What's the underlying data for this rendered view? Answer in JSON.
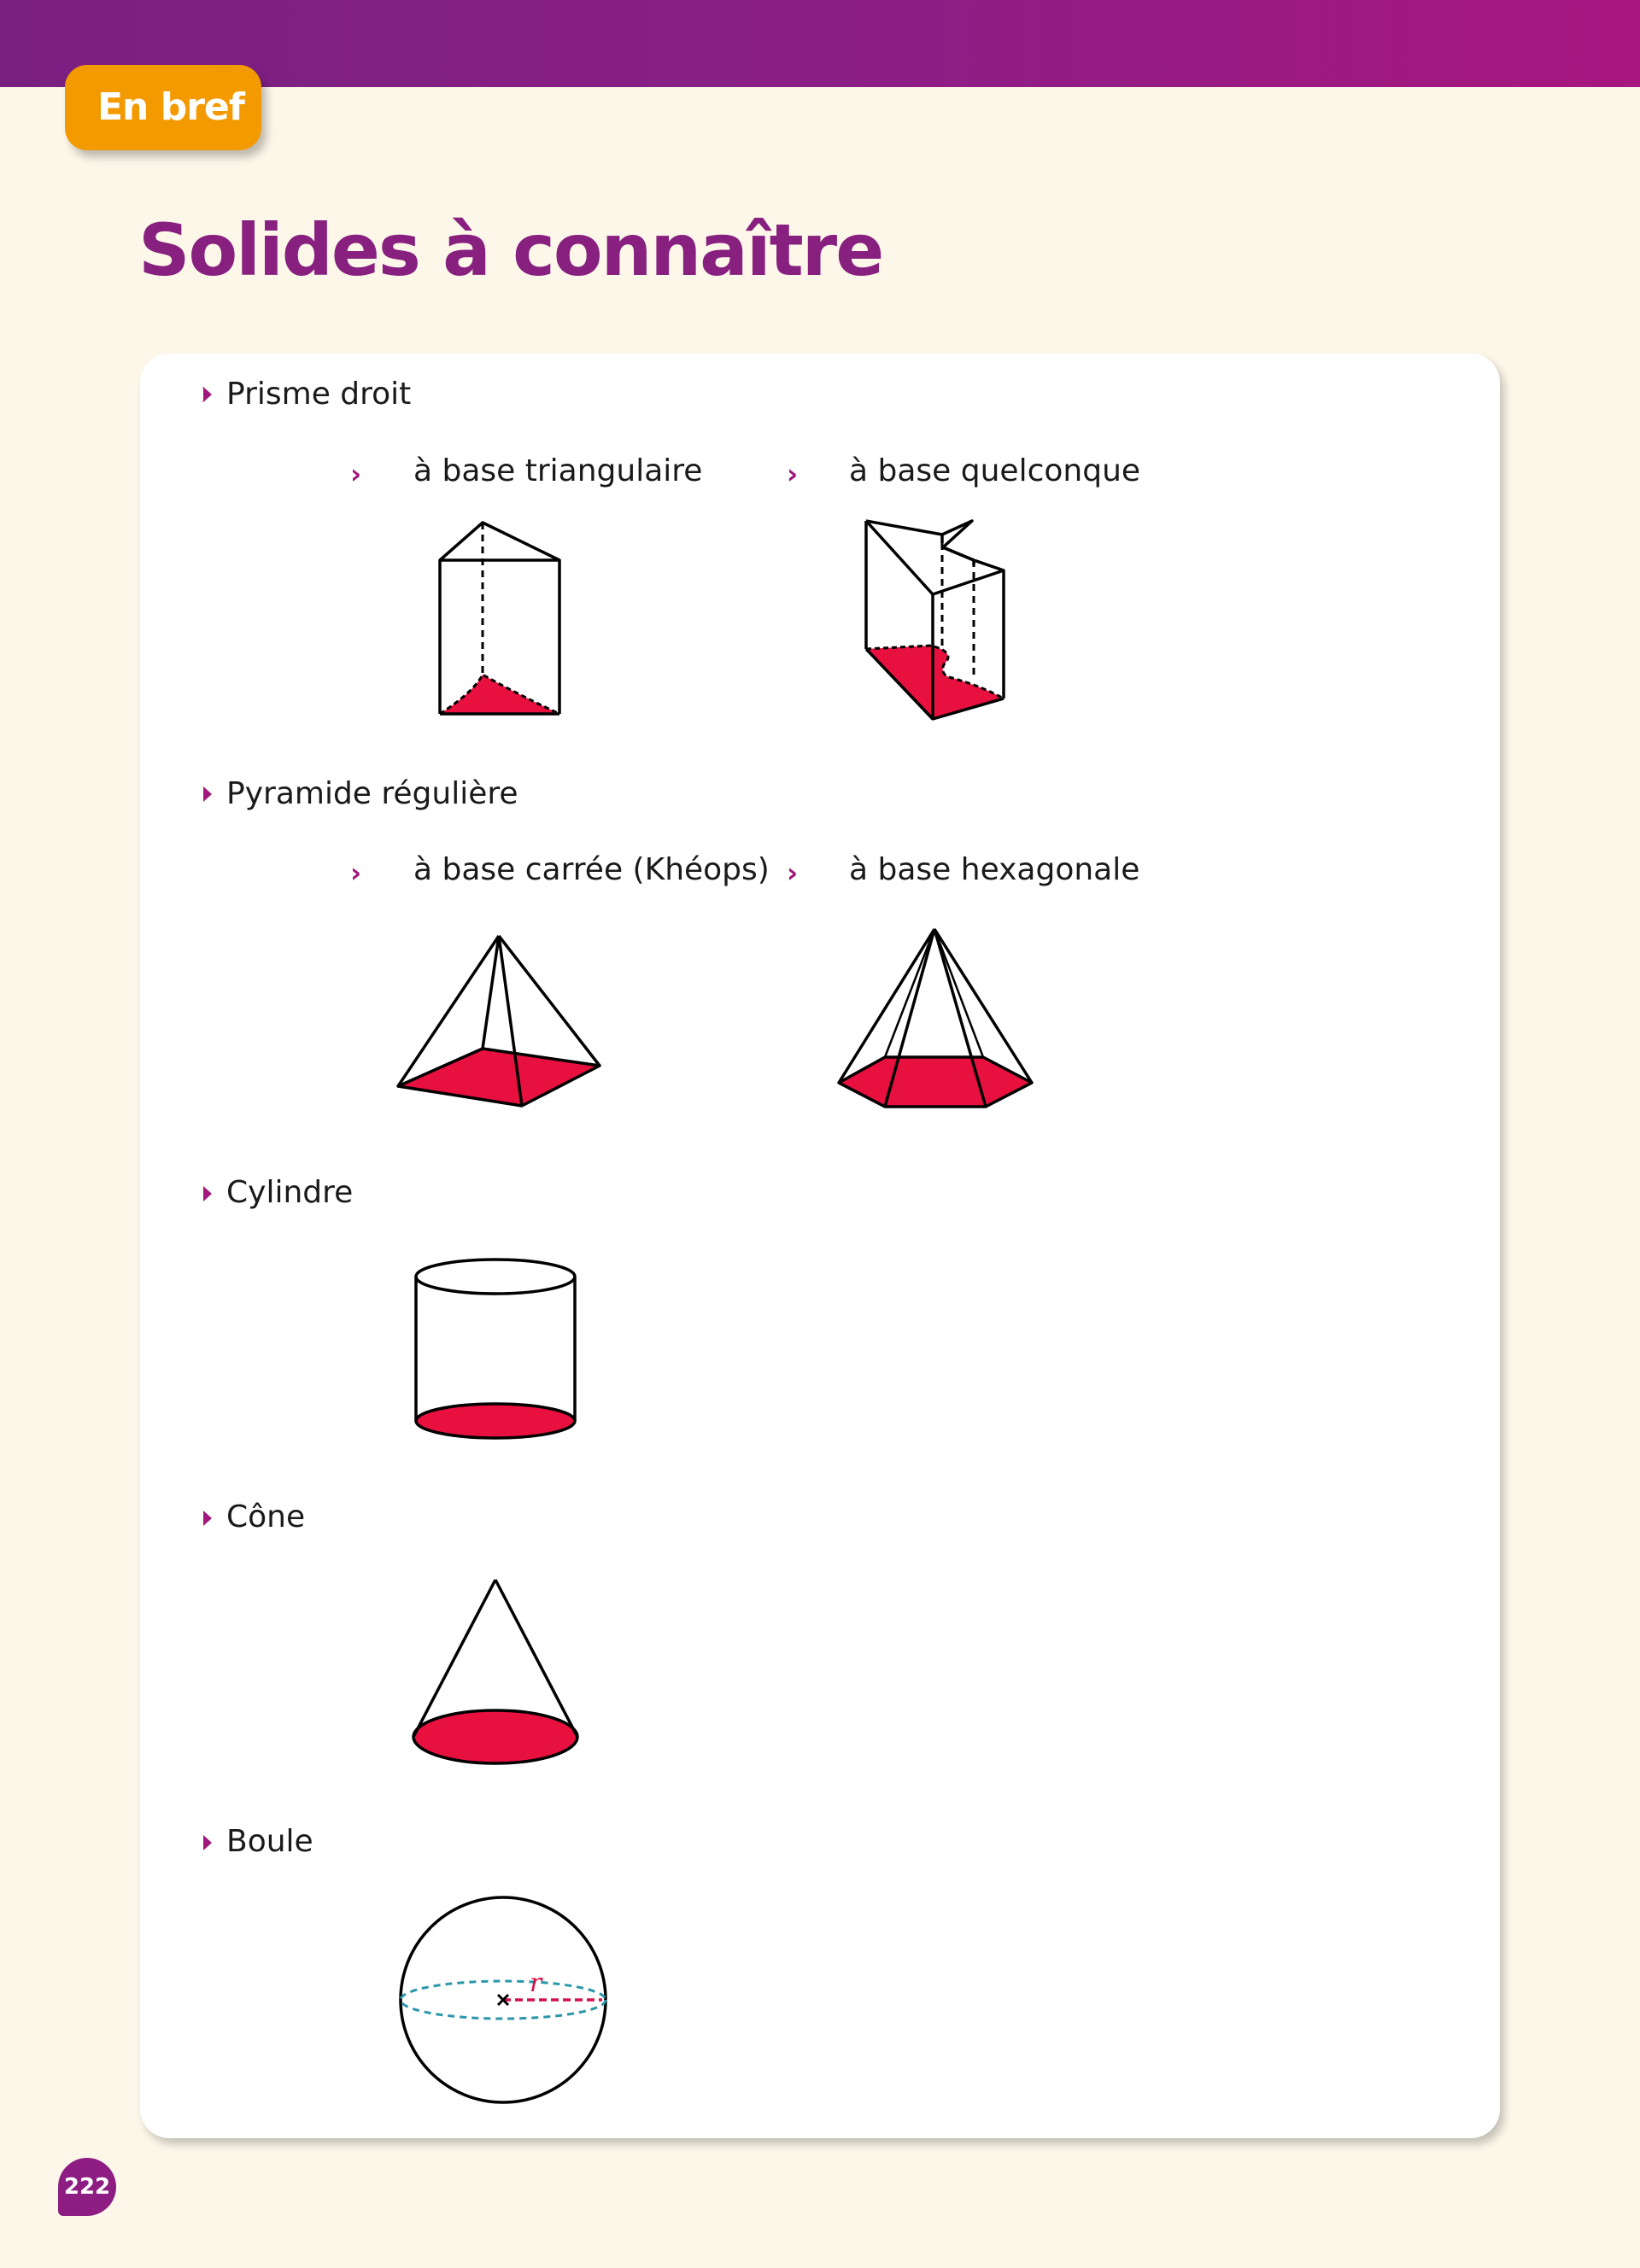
{
  "header": {
    "badge_label": "En bref",
    "title": "Solides à connaître",
    "accent_color": "#87207f",
    "badge_color": "#f39a00"
  },
  "sections": {
    "prisme": {
      "label": "Prisme droit",
      "items": [
        {
          "label": "à base triangulaire",
          "figure": "triangular-prism-icon"
        },
        {
          "label": "à base quelconque",
          "figure": "irregular-prism-icon"
        }
      ]
    },
    "pyramide": {
      "label": "Pyramide régulière",
      "items": [
        {
          "label": "à base carrée (Khéops)",
          "figure": "square-pyramid-icon"
        },
        {
          "label": "à base hexagonale",
          "figure": "hexagonal-pyramid-icon"
        }
      ]
    },
    "cylindre": {
      "label": "Cylindre",
      "figure": "cylinder-icon"
    },
    "cone": {
      "label": "Cône",
      "figure": "cone-icon"
    },
    "boule": {
      "label": "Boule",
      "figure": "sphere-icon",
      "radius_label": "r"
    }
  },
  "colors": {
    "base_fill": "#e8103f",
    "radius_line": "#d2124a",
    "equator_line": "#2a97a8"
  },
  "page_number": "222"
}
